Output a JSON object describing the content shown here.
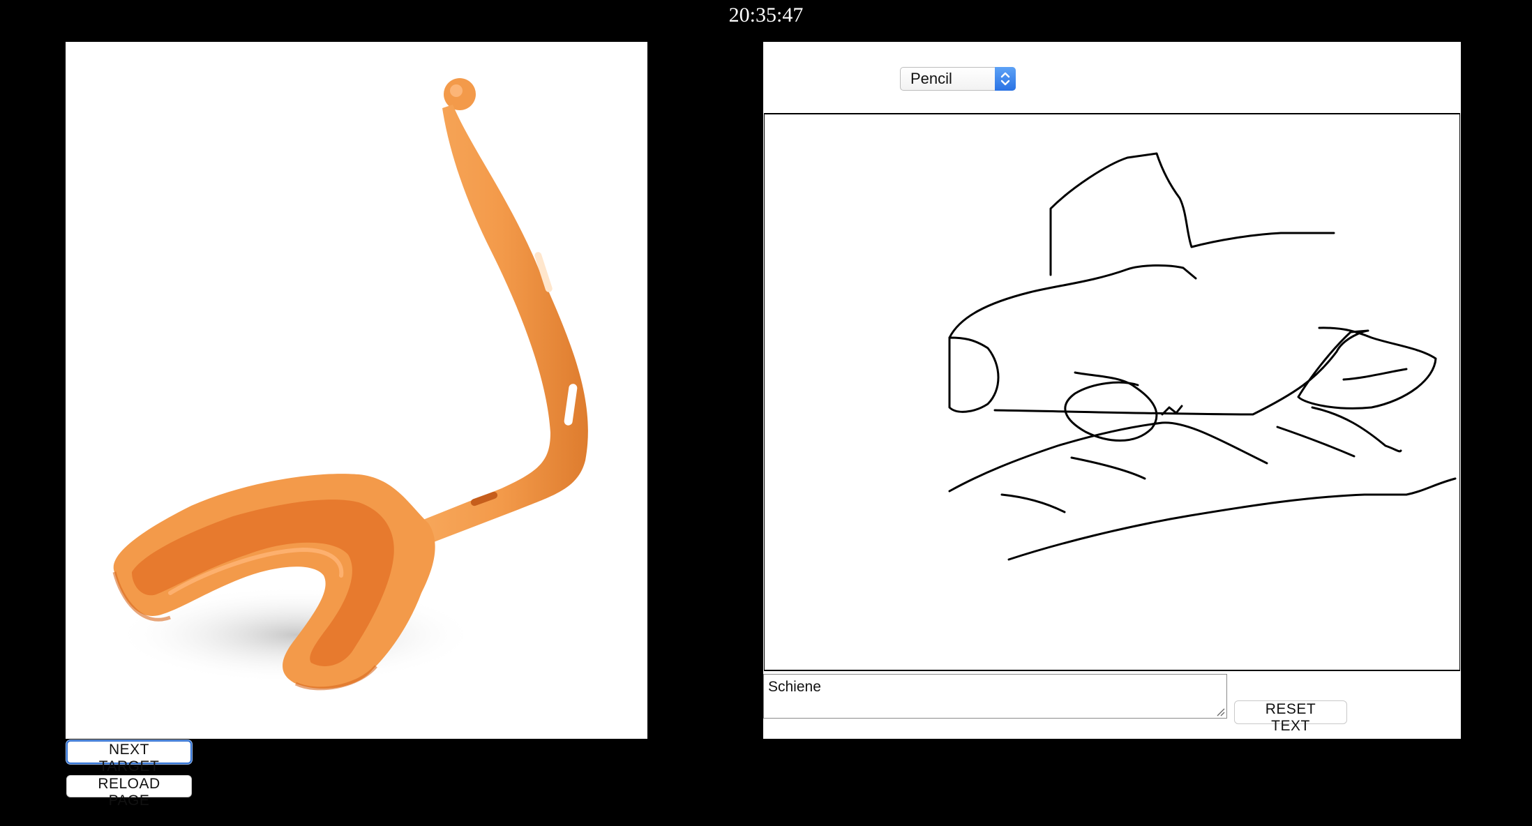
{
  "clock": {
    "time": "20:35:47"
  },
  "target": {
    "image_subject": "orange-mouthguard",
    "colors": {
      "body": "#f39a4a",
      "inner": "#e77a2e",
      "shade": "#d96a22",
      "highlight": "#ffc08a"
    }
  },
  "buttons": {
    "next_target": "NEXT TARGET",
    "reload_page": "RELOAD PAGE",
    "reset_text": "RESET TEXT"
  },
  "drawing": {
    "tool_select": {
      "selected": "Pencil"
    },
    "stroke_color": "#000000"
  },
  "text_input": {
    "value": "Schiene"
  },
  "icons": {
    "select_arrows": "up-down-chevron-icon",
    "resize_grip": "resize-grip-icon"
  }
}
